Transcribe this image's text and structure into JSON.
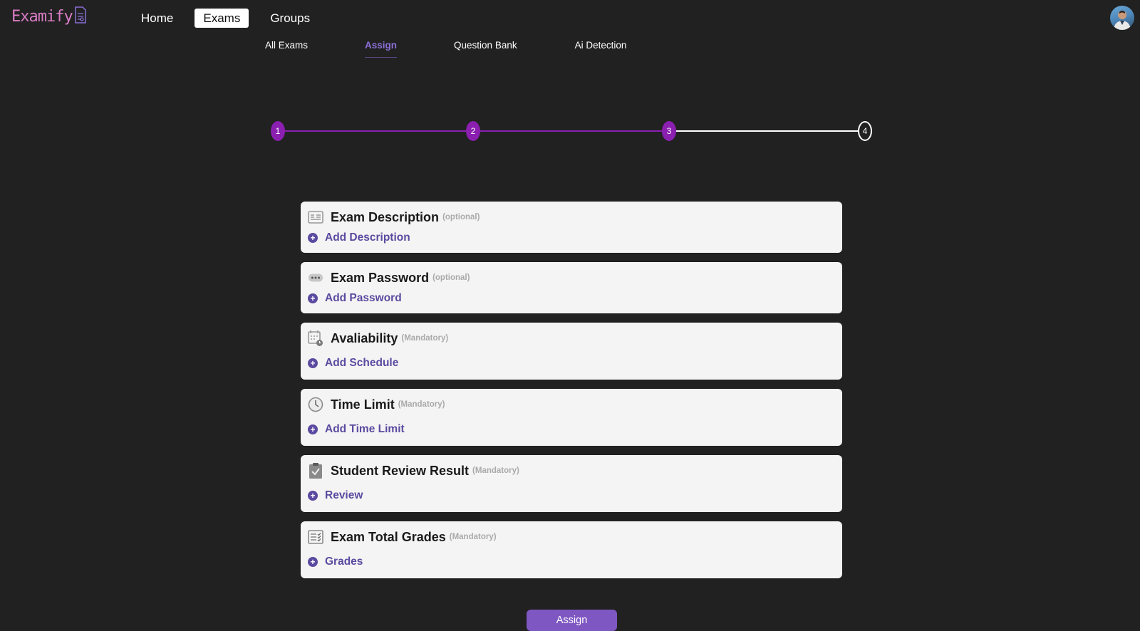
{
  "app": {
    "logo_text": "Examify"
  },
  "nav": {
    "items": [
      {
        "label": "Home",
        "active": false
      },
      {
        "label": "Exams",
        "active": true
      },
      {
        "label": "Groups",
        "active": false
      }
    ]
  },
  "subnav": {
    "items": [
      {
        "label": "All Exams",
        "active": false
      },
      {
        "label": "Assign",
        "active": true
      },
      {
        "label": "Question Bank",
        "active": false
      },
      {
        "label": "Ai Detection",
        "active": false
      }
    ]
  },
  "stepper": {
    "steps": [
      "1",
      "2",
      "3",
      "4"
    ],
    "current_step": 3,
    "colors": {
      "done": "#8a1fb0",
      "todo": "#ffffff"
    }
  },
  "sections": [
    {
      "title": "Exam Description",
      "tag": "(optional)",
      "action": "Add Description",
      "icon": "description-icon"
    },
    {
      "title": "Exam Password",
      "tag": "(optional)",
      "action": "Add Password",
      "icon": "password-icon"
    },
    {
      "title": "Avaliability",
      "tag": "(Mandatory)",
      "action": "Add Schedule",
      "icon": "calendar-icon"
    },
    {
      "title": "Time Limit",
      "tag": "(Mandatory)",
      "action": "Add Time Limit",
      "icon": "clock-icon"
    },
    {
      "title": "Student Review Result",
      "tag": "(Mandatory)",
      "action": "Review",
      "icon": "clipboard-check-icon"
    },
    {
      "title": "Exam Total Grades",
      "tag": "(Mandatory)",
      "action": "Grades",
      "icon": "checklist-icon"
    }
  ],
  "assign_button": {
    "label": "Assign"
  },
  "colors": {
    "accent": "#5b4aa0",
    "button": "#7e57c2",
    "background": "#212121"
  }
}
